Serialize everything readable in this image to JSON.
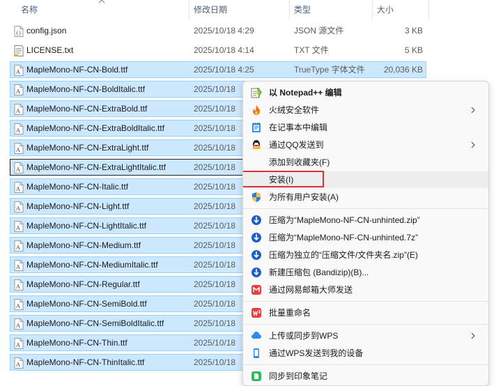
{
  "columns": {
    "name": "名称",
    "date": "修改日期",
    "type": "类型",
    "size": "大小"
  },
  "files": [
    {
      "name": "config.json",
      "date": "2025/10/18 4:29",
      "type": "JSON 源文件",
      "size": "3 KB",
      "icon": "json-file-icon",
      "selected": false
    },
    {
      "name": "LICENSE.txt",
      "date": "2025/10/18 4:14",
      "type": "TXT 文件",
      "size": "5 KB",
      "icon": "text-file-icon",
      "selected": false
    },
    {
      "name": "MapleMono-NF-CN-Bold.ttf",
      "date": "2025/10/18 4:25",
      "type": "TrueType 字体文件",
      "size": "20,036 KB",
      "icon": "font-file-icon",
      "selected": true
    },
    {
      "name": "MapleMono-NF-CN-BoldItalic.ttf",
      "date": "2025/10/18",
      "icon": "font-file-icon",
      "selected": true
    },
    {
      "name": "MapleMono-NF-CN-ExtraBold.ttf",
      "date": "2025/10/18",
      "icon": "font-file-icon",
      "selected": true
    },
    {
      "name": "MapleMono-NF-CN-ExtraBoldItalic.ttf",
      "date": "2025/10/18",
      "icon": "font-file-icon",
      "selected": true
    },
    {
      "name": "MapleMono-NF-CN-ExtraLight.ttf",
      "date": "2025/10/18",
      "icon": "font-file-icon",
      "selected": true
    },
    {
      "name": "MapleMono-NF-CN-ExtraLightItalic.ttf",
      "date": "2025/10/18",
      "icon": "font-file-icon",
      "selected": true,
      "focused": true
    },
    {
      "name": "MapleMono-NF-CN-Italic.ttf",
      "date": "2025/10/18",
      "icon": "font-file-icon",
      "selected": true
    },
    {
      "name": "MapleMono-NF-CN-Light.ttf",
      "date": "2025/10/18",
      "icon": "font-file-icon",
      "selected": true
    },
    {
      "name": "MapleMono-NF-CN-LightItalic.ttf",
      "date": "2025/10/18",
      "icon": "font-file-icon",
      "selected": true
    },
    {
      "name": "MapleMono-NF-CN-Medium.ttf",
      "date": "2025/10/18",
      "icon": "font-file-icon",
      "selected": true
    },
    {
      "name": "MapleMono-NF-CN-MediumItalic.ttf",
      "date": "2025/10/18",
      "icon": "font-file-icon",
      "selected": true
    },
    {
      "name": "MapleMono-NF-CN-Regular.ttf",
      "date": "2025/10/18",
      "icon": "font-file-icon",
      "selected": true
    },
    {
      "name": "MapleMono-NF-CN-SemiBold.ttf",
      "date": "2025/10/18",
      "icon": "font-file-icon",
      "selected": true
    },
    {
      "name": "MapleMono-NF-CN-SemiBoldItalic.ttf",
      "date": "2025/10/18",
      "icon": "font-file-icon",
      "selected": true
    },
    {
      "name": "MapleMono-NF-CN-Thin.ttf",
      "date": "2025/10/18",
      "icon": "font-file-icon",
      "selected": true
    },
    {
      "name": "MapleMono-NF-CN-ThinItalic.ttf",
      "date": "2025/10/18",
      "icon": "font-file-icon",
      "selected": true
    }
  ],
  "context_menu": {
    "items": [
      {
        "label": "以 Notepad++ 编辑",
        "icon": "notepadpp-icon",
        "bold": true
      },
      {
        "label": "火绒安全软件",
        "icon": "huorong-icon",
        "submenu": true
      },
      {
        "label": "在记事本中编辑",
        "icon": "notepad-icon"
      },
      {
        "label": "通过QQ发送到",
        "icon": "qq-icon",
        "submenu": true
      },
      {
        "label": "添加到收藏夹(F)",
        "icon": ""
      },
      {
        "label": "安装(I)",
        "icon": "",
        "highlighted": true
      },
      {
        "label": "为所有用户安装(A)",
        "icon": "uac-shield-icon"
      },
      {
        "separator": true
      },
      {
        "label": "压缩为“MapleMono-NF-CN-unhinted.zip”",
        "icon": "bandizip-icon"
      },
      {
        "label": "压缩为“MapleMono-NF-CN-unhinted.7z”",
        "icon": "bandizip-icon"
      },
      {
        "label": "压缩为独立的“压缩文件/文件夹名.zip”(E)",
        "icon": "bandizip-icon"
      },
      {
        "label": "新建压缩包 (Bandizip)(B)...",
        "icon": "bandizip-icon"
      },
      {
        "label": "通过网易邮箱大师发送",
        "icon": "netease-mail-icon"
      },
      {
        "separator": true
      },
      {
        "label": "批量重命名",
        "icon": "wps-icon"
      },
      {
        "separator": true
      },
      {
        "label": "上传或同步到WPS",
        "icon": "wps-cloud-icon",
        "submenu": true
      },
      {
        "label": "通过WPS发送到我的设备",
        "icon": "wps-device-icon"
      },
      {
        "separator": true
      },
      {
        "label": "同步到印象笔记",
        "icon": "evernote-icon"
      }
    ]
  },
  "colors": {
    "selection_bg": "#cce8ff",
    "selection_border": "#99d1ff",
    "highlight_box": "#d9323a",
    "menu_bg": "#f9f9f9"
  }
}
